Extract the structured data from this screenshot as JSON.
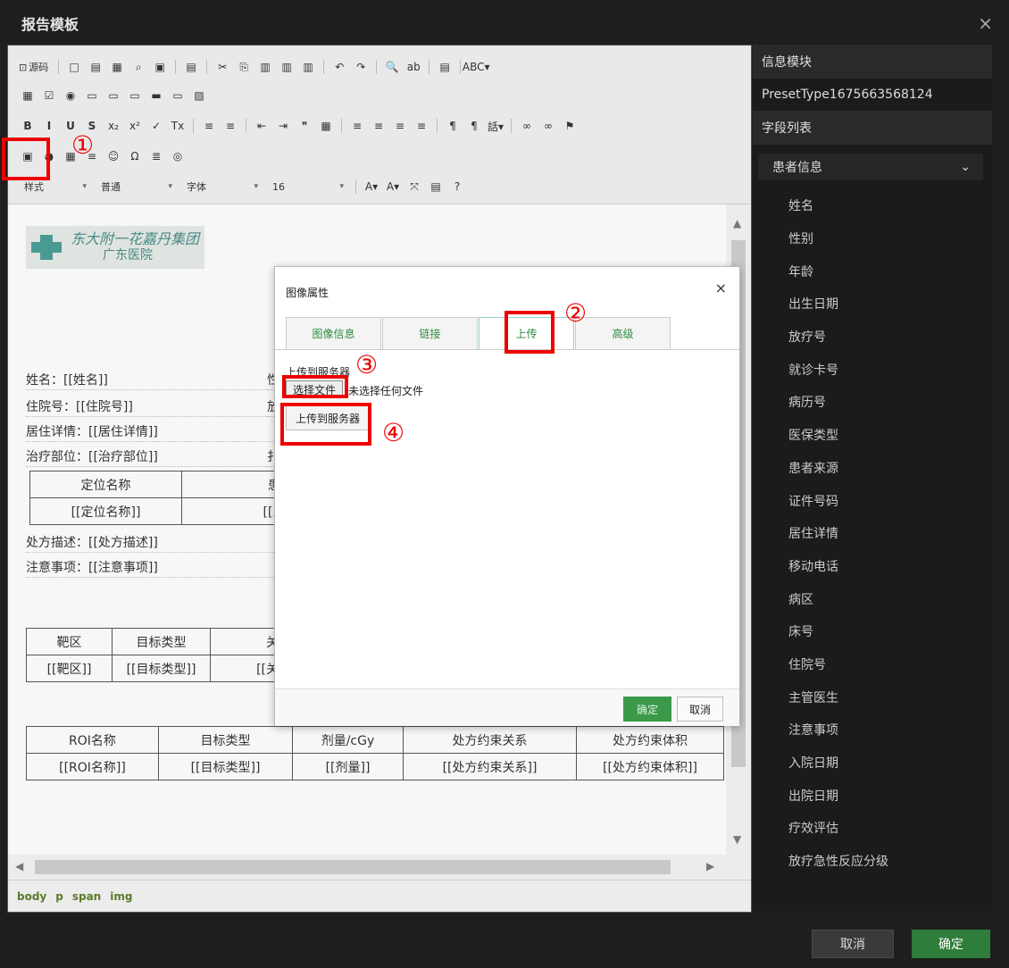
{
  "window": {
    "title": "报告模板",
    "close": "×"
  },
  "toolbar": {
    "source_label": "源码",
    "row1": [
      "□",
      "▤",
      "▦",
      "⌕",
      "▣",
      "|",
      "▤",
      "|",
      "✂",
      "⎘",
      "▥",
      "▥",
      "▥",
      "|",
      "↶",
      "↷",
      "|",
      "🔍",
      "ab",
      "|",
      "▤",
      "|",
      "ABC▾"
    ],
    "row2": [
      "▦",
      "☑",
      "◉",
      "▭",
      "▭",
      "▭",
      "▬",
      "▭",
      "▨"
    ],
    "row3": [
      "B",
      "I",
      "U",
      "S",
      "x₂",
      "x²",
      "✓",
      "Tx",
      "|",
      "≡",
      "≡",
      "|",
      "⇤",
      "⇥",
      "❞",
      "▦",
      "|",
      "≡",
      "≡",
      "≡",
      "≡",
      "|",
      "¶",
      "¶",
      "話▾",
      "|",
      "∞",
      "∞",
      "⚑"
    ],
    "row4": [
      "▣",
      "◕",
      "▦",
      "≡",
      "☺",
      "Ω",
      "≣",
      "◎"
    ],
    "styles_combo": "样式",
    "format_combo": "普通",
    "font_combo": "字体",
    "size_combo": "16",
    "row5_icons": [
      "A▾",
      "A▾",
      "⤧",
      "▤",
      "?"
    ]
  },
  "document": {
    "logo_line1": "东大附一花嘉丹集团",
    "logo_line2": "广东医院",
    "fields": [
      {
        "text": "姓名：[[姓名]]",
        "right": "性"
      },
      {
        "text": "住院号：[[住院号]]",
        "right": "放"
      },
      {
        "text": "居住详情：[[居住详情]]",
        "right": ""
      },
      {
        "text": "治疗部位：[[治疗部位]]",
        "right": "扌"
      }
    ],
    "table1": {
      "headers": [
        "定位名称",
        "患者体位"
      ],
      "row": [
        "[[定位名称]]",
        "[[患者体位"
      ]
    },
    "notes": [
      "处方描述：[[处方描述]]",
      "注意事项：[[注意事项]]"
    ],
    "table2": {
      "headers": [
        "靶区",
        "目标类型",
        "关系"
      ],
      "row": [
        "[[靶区]]",
        "[[目标类型]]",
        "[[关系]]"
      ]
    },
    "table3": {
      "headers": [
        "ROI名称",
        "目标类型",
        "剂量/cGy",
        "处方约束关系",
        "处方约束体积"
      ],
      "row": [
        "[[ROI名称]]",
        "[[目标类型]]",
        "[[剂量]]",
        "[[处方约束关系]]",
        "[[处方约束体积]]"
      ]
    }
  },
  "statusbar": [
    "body",
    "p",
    "span",
    "img"
  ],
  "right_panel": {
    "section_title": "信息模块",
    "preset": "PresetType1675663568124",
    "fields_title": "字段列表",
    "group": "患者信息",
    "group_chevron": "⌄",
    "items": [
      "姓名",
      "性别",
      "年龄",
      "出生日期",
      "放疗号",
      "就诊卡号",
      "病历号",
      "医保类型",
      "患者来源",
      "证件号码",
      "居住详情",
      "移动电话",
      "病区",
      "床号",
      "住院号",
      "主管医生",
      "注意事项",
      "入院日期",
      "出院日期",
      "疗效评估",
      "放疗急性反应分级"
    ]
  },
  "footer": {
    "cancel": "取消",
    "ok": "确定"
  },
  "image_dialog": {
    "title": "图像属性",
    "close": "×",
    "tabs": [
      "图像信息",
      "链接",
      "上传",
      "高级"
    ],
    "active_tab": "上传",
    "upload_label": "上传到服务器",
    "choose_file": "选择文件",
    "no_file": "未选择任何文件",
    "upload_button": "上传到服务器",
    "ok": "确定",
    "cancel": "取消"
  },
  "annotations": [
    "①",
    "②",
    "③",
    "④"
  ]
}
